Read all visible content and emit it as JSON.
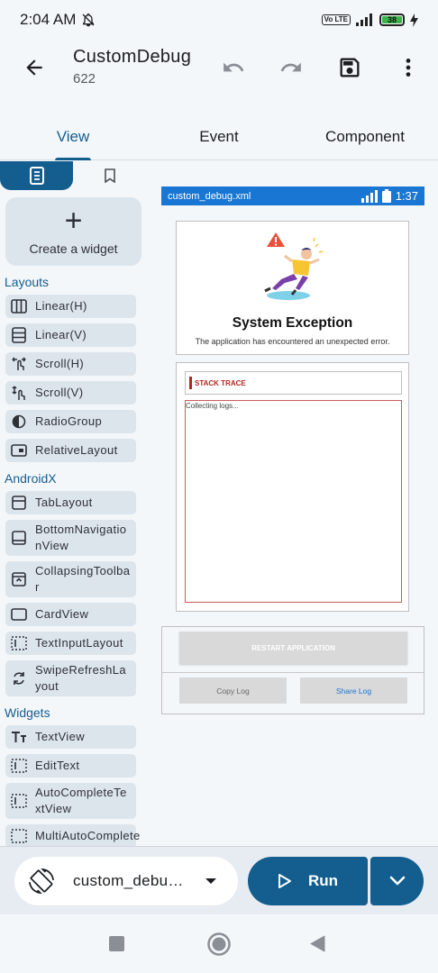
{
  "status": {
    "time": "2:04 AM",
    "network_badge": "Vo LTE",
    "battery": "38"
  },
  "toolbar": {
    "title": "CustomDebug",
    "subtitle": "622"
  },
  "tabs": [
    {
      "label": "View"
    },
    {
      "label": "Event"
    },
    {
      "label": "Component"
    }
  ],
  "palette": {
    "create_label": "Create a widget",
    "sections": [
      {
        "title": "Layouts",
        "items": [
          {
            "label": "Linear(H)",
            "icon": "columns-icon"
          },
          {
            "label": "Linear(V)",
            "icon": "rows-icon"
          },
          {
            "label": "Scroll(H)",
            "icon": "swipe-horizontal-icon"
          },
          {
            "label": "Scroll(V)",
            "icon": "swipe-vertical-icon"
          },
          {
            "label": "RadioGroup",
            "icon": "radio-group-icon"
          },
          {
            "label": "RelativeLayout",
            "icon": "relative-layout-icon"
          }
        ]
      },
      {
        "title": "AndroidX",
        "items": [
          {
            "label": "TabLayout",
            "icon": "tab-layout-icon"
          },
          {
            "label": "BottomNavigationView",
            "icon": "bottom-nav-icon"
          },
          {
            "label": "CollapsingToolbar",
            "icon": "collapsing-toolbar-icon"
          },
          {
            "label": "CardView",
            "icon": "card-view-icon"
          },
          {
            "label": "TextInputLayout",
            "icon": "text-input-icon"
          },
          {
            "label": "SwipeRefreshLayout",
            "icon": "refresh-icon"
          }
        ]
      },
      {
        "title": "Widgets",
        "items": [
          {
            "label": "TextView",
            "icon": "text-size-icon"
          },
          {
            "label": "EditText",
            "icon": "edit-text-icon"
          },
          {
            "label": "AutoCompleteTextView",
            "icon": "autocomplete-icon"
          },
          {
            "label": "MultiAutoComplete",
            "icon": "multi-autocomplete-icon"
          }
        ]
      }
    ]
  },
  "preview": {
    "file_name": "custom_debug.xml",
    "time": "1:37",
    "exception_title": "System Exception",
    "exception_message": "The application has encountered an unexpected error.",
    "stack_trace_label": "STACK TRACE",
    "log_text": "Collecting logs...",
    "restart_label": "RESTART APPLICATION",
    "copy_label": "Copy Log",
    "share_label": "Share Log"
  },
  "bottom": {
    "layout_name": "custom_debu…",
    "run_label": "Run"
  },
  "colors": {
    "accent": "#135d8f",
    "preview_bar": "#1976d2",
    "error_red": "#b3261e"
  }
}
